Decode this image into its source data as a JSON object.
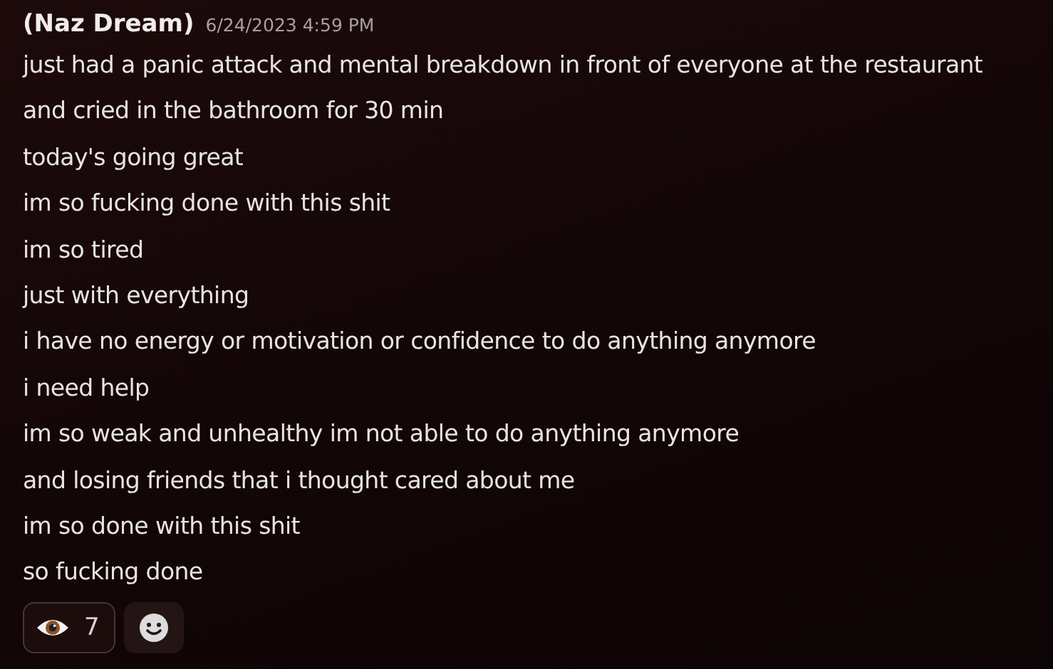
{
  "message": {
    "author": "(Naz Dream)",
    "timestamp": "6/24/2023 4:59 PM",
    "lines": [
      "just had a panic attack and mental breakdown in front of everyone at the restaurant",
      "and cried in the bathroom for 30 min",
      "today's going great",
      "im so fucking done with this shit",
      "im so tired",
      "just with everything",
      "i have no energy or motivation or confidence to do anything anymore",
      "i need help",
      "im so weak and unhealthy im not able to do anything anymore",
      "and losing friends that i thought cared about me",
      "im so done with this shit",
      "so fucking done"
    ],
    "reactions": [
      {
        "count": "7"
      }
    ]
  }
}
